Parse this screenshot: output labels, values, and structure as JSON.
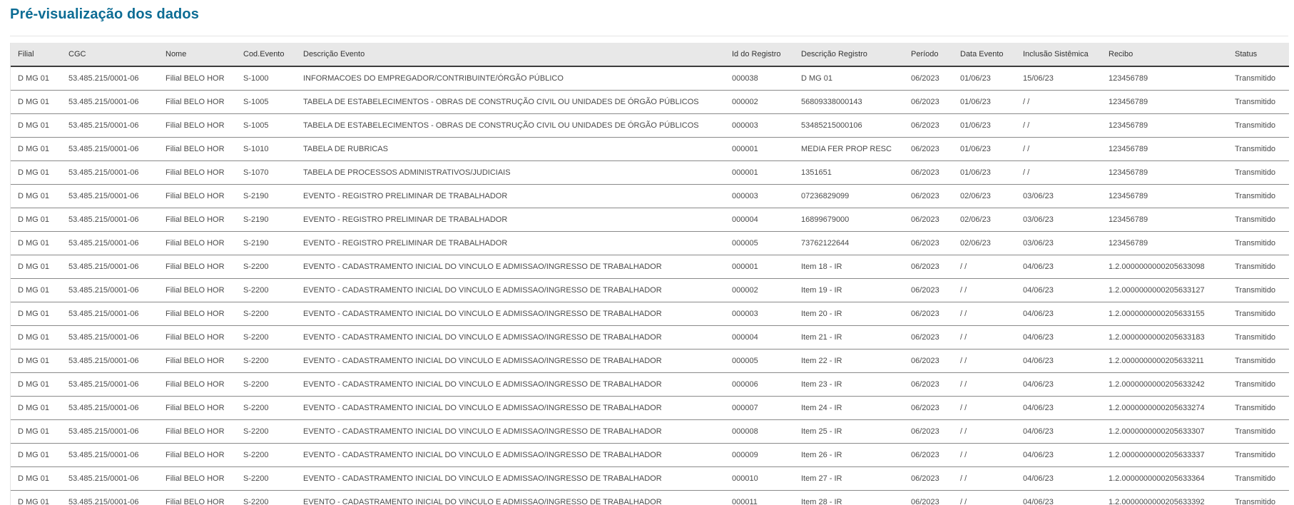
{
  "page": {
    "title": "Pré-visualização dos dados"
  },
  "table": {
    "columns": [
      "Filial",
      "CGC",
      "Nome",
      "Cod.Evento",
      "Descrição Evento",
      "Id do Registro",
      "Descrição Registro",
      "Período",
      "Data Evento",
      "Inclusão Sistêmica",
      "Recibo",
      "Status"
    ],
    "rows": [
      [
        "D MG 01",
        "53.485.215/0001-06",
        "Filial BELO HOR",
        "S-1000",
        "INFORMACOES DO EMPREGADOR/CONTRIBUINTE/ÓRGÃO PÚBLICO",
        "000038",
        "D MG 01",
        "06/2023",
        "01/06/23",
        "15/06/23",
        "123456789",
        "Transmitido"
      ],
      [
        "D MG 01",
        "53.485.215/0001-06",
        "Filial BELO HOR",
        "S-1005",
        "TABELA DE ESTABELECIMENTOS - OBRAS DE CONSTRUÇÃO CIVIL OU UNIDADES DE ÓRGÃO PÚBLICOS",
        "000002",
        "56809338000143",
        "06/2023",
        "01/06/23",
        "/ /",
        "123456789",
        "Transmitido"
      ],
      [
        "D MG 01",
        "53.485.215/0001-06",
        "Filial BELO HOR",
        "S-1005",
        "TABELA DE ESTABELECIMENTOS - OBRAS DE CONSTRUÇÃO CIVIL OU UNIDADES DE ÓRGÃO PÚBLICOS",
        "000003",
        "53485215000106",
        "06/2023",
        "01/06/23",
        "/ /",
        "123456789",
        "Transmitido"
      ],
      [
        "D MG 01",
        "53.485.215/0001-06",
        "Filial BELO HOR",
        "S-1010",
        "TABELA DE RUBRICAS",
        "000001",
        "MEDIA FER PROP RESC",
        "06/2023",
        "01/06/23",
        "/ /",
        "123456789",
        "Transmitido"
      ],
      [
        "D MG 01",
        "53.485.215/0001-06",
        "Filial BELO HOR",
        "S-1070",
        "TABELA DE PROCESSOS ADMINISTRATIVOS/JUDICIAIS",
        "000001",
        "1351651",
        "06/2023",
        "01/06/23",
        "/ /",
        "123456789",
        "Transmitido"
      ],
      [
        "D MG 01",
        "53.485.215/0001-06",
        "Filial BELO HOR",
        "S-2190",
        "EVENTO - REGISTRO PRELIMINAR DE TRABALHADOR",
        "000003",
        "07236829099",
        "06/2023",
        "02/06/23",
        "03/06/23",
        "123456789",
        "Transmitido"
      ],
      [
        "D MG 01",
        "53.485.215/0001-06",
        "Filial BELO HOR",
        "S-2190",
        "EVENTO - REGISTRO PRELIMINAR DE TRABALHADOR",
        "000004",
        "16899679000",
        "06/2023",
        "02/06/23",
        "03/06/23",
        "123456789",
        "Transmitido"
      ],
      [
        "D MG 01",
        "53.485.215/0001-06",
        "Filial BELO HOR",
        "S-2190",
        "EVENTO - REGISTRO PRELIMINAR DE TRABALHADOR",
        "000005",
        "73762122644",
        "06/2023",
        "02/06/23",
        "03/06/23",
        "123456789",
        "Transmitido"
      ],
      [
        "D MG 01",
        "53.485.215/0001-06",
        "Filial BELO HOR",
        "S-2200",
        "EVENTO - CADASTRAMENTO INICIAL DO VINCULO E ADMISSAO/INGRESSO DE TRABALHADOR",
        "000001",
        "Item 18 - IR",
        "06/2023",
        "/ /",
        "04/06/23",
        "1.2.0000000000205633098",
        "Transmitido"
      ],
      [
        "D MG 01",
        "53.485.215/0001-06",
        "Filial BELO HOR",
        "S-2200",
        "EVENTO - CADASTRAMENTO INICIAL DO VINCULO E ADMISSAO/INGRESSO DE TRABALHADOR",
        "000002",
        "Item 19 - IR",
        "06/2023",
        "/ /",
        "04/06/23",
        "1.2.0000000000205633127",
        "Transmitido"
      ],
      [
        "D MG 01",
        "53.485.215/0001-06",
        "Filial BELO HOR",
        "S-2200",
        "EVENTO - CADASTRAMENTO INICIAL DO VINCULO E ADMISSAO/INGRESSO DE TRABALHADOR",
        "000003",
        "Item 20 - IR",
        "06/2023",
        "/ /",
        "04/06/23",
        "1.2.0000000000205633155",
        "Transmitido"
      ],
      [
        "D MG 01",
        "53.485.215/0001-06",
        "Filial BELO HOR",
        "S-2200",
        "EVENTO - CADASTRAMENTO INICIAL DO VINCULO E ADMISSAO/INGRESSO DE TRABALHADOR",
        "000004",
        "Item 21 - IR",
        "06/2023",
        "/ /",
        "04/06/23",
        "1.2.0000000000205633183",
        "Transmitido"
      ],
      [
        "D MG 01",
        "53.485.215/0001-06",
        "Filial BELO HOR",
        "S-2200",
        "EVENTO - CADASTRAMENTO INICIAL DO VINCULO E ADMISSAO/INGRESSO DE TRABALHADOR",
        "000005",
        "Item 22 - IR",
        "06/2023",
        "/ /",
        "04/06/23",
        "1.2.0000000000205633211",
        "Transmitido"
      ],
      [
        "D MG 01",
        "53.485.215/0001-06",
        "Filial BELO HOR",
        "S-2200",
        "EVENTO - CADASTRAMENTO INICIAL DO VINCULO E ADMISSAO/INGRESSO DE TRABALHADOR",
        "000006",
        "Item 23 - IR",
        "06/2023",
        "/ /",
        "04/06/23",
        "1.2.0000000000205633242",
        "Transmitido"
      ],
      [
        "D MG 01",
        "53.485.215/0001-06",
        "Filial BELO HOR",
        "S-2200",
        "EVENTO - CADASTRAMENTO INICIAL DO VINCULO E ADMISSAO/INGRESSO DE TRABALHADOR",
        "000007",
        "Item 24 - IR",
        "06/2023",
        "/ /",
        "04/06/23",
        "1.2.0000000000205633274",
        "Transmitido"
      ],
      [
        "D MG 01",
        "53.485.215/0001-06",
        "Filial BELO HOR",
        "S-2200",
        "EVENTO - CADASTRAMENTO INICIAL DO VINCULO E ADMISSAO/INGRESSO DE TRABALHADOR",
        "000008",
        "Item 25 - IR",
        "06/2023",
        "/ /",
        "04/06/23",
        "1.2.0000000000205633307",
        "Transmitido"
      ],
      [
        "D MG 01",
        "53.485.215/0001-06",
        "Filial BELO HOR",
        "S-2200",
        "EVENTO - CADASTRAMENTO INICIAL DO VINCULO E ADMISSAO/INGRESSO DE TRABALHADOR",
        "000009",
        "Item 26 - IR",
        "06/2023",
        "/ /",
        "04/06/23",
        "1.2.0000000000205633337",
        "Transmitido"
      ],
      [
        "D MG 01",
        "53.485.215/0001-06",
        "Filial BELO HOR",
        "S-2200",
        "EVENTO - CADASTRAMENTO INICIAL DO VINCULO E ADMISSAO/INGRESSO DE TRABALHADOR",
        "000010",
        "Item 27 - IR",
        "06/2023",
        "/ /",
        "04/06/23",
        "1.2.0000000000205633364",
        "Transmitido"
      ],
      [
        "D MG 01",
        "53.485.215/0001-06",
        "Filial BELO HOR",
        "S-2200",
        "EVENTO - CADASTRAMENTO INICIAL DO VINCULO E ADMISSAO/INGRESSO DE TRABALHADOR",
        "000011",
        "Item 28 - IR",
        "06/2023",
        "/ /",
        "04/06/23",
        "1.2.0000000000205633392",
        "Transmitido"
      ]
    ]
  }
}
